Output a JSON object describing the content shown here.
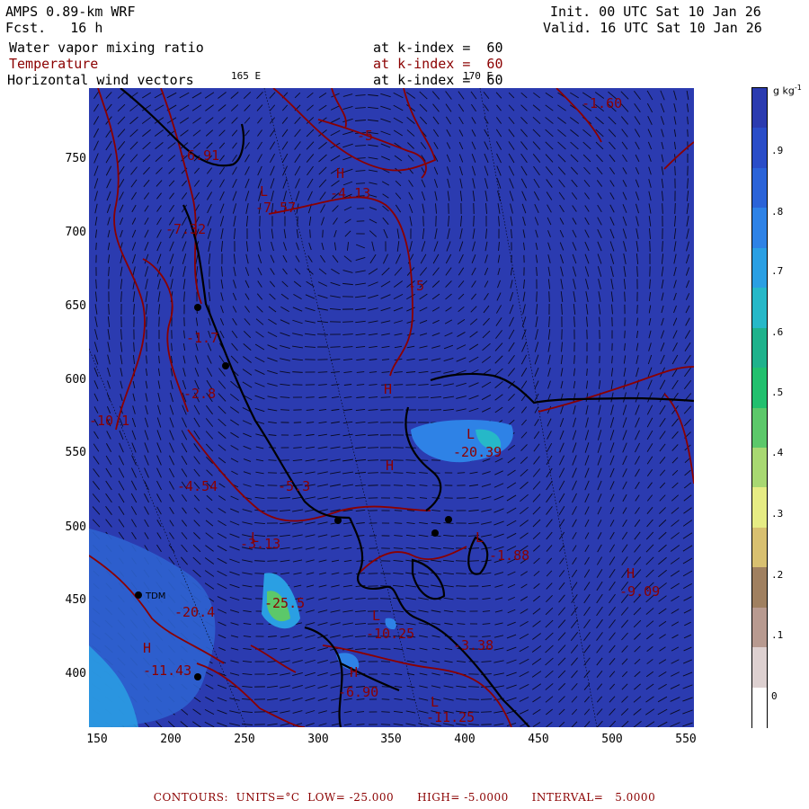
{
  "header": {
    "model": "AMPS 0.89-km WRF",
    "forecast": "Fcst.   16 h",
    "init": "Init. 00 UTC Sat 10 Jan 26",
    "valid": "Valid. 16 UTC Sat 10 Jan 26",
    "fields": [
      {
        "name": "Water vapor mixing ratio",
        "level": "at k-index =  60",
        "color": "#000000"
      },
      {
        "name": "Temperature",
        "level": "at k-index =  60",
        "color": "#8b0000"
      },
      {
        "name": "Horizontal wind vectors",
        "level": "at k-index =  60",
        "color": "#000000"
      }
    ]
  },
  "map": {
    "longitude_labels": [
      "165 E",
      "170 E"
    ],
    "x_ticks": [
      "150",
      "200",
      "250",
      "300",
      "350",
      "400",
      "450",
      "500",
      "550"
    ],
    "y_ticks": [
      "750",
      "700",
      "650",
      "600",
      "550",
      "500",
      "450",
      "400"
    ],
    "background_color": "#2b3bb0",
    "station_label": "TDM",
    "contour_labels": [
      {
        "text": "-1.60"
      },
      {
        "text": "-6.91"
      },
      {
        "text": "-7.57"
      },
      {
        "text": "-4.13"
      },
      {
        "text": "-5"
      },
      {
        "text": "-5"
      },
      {
        "text": "-7.32"
      },
      {
        "text": "-1.7"
      },
      {
        "text": "-2.8"
      },
      {
        "text": "-10.1"
      },
      {
        "text": "-4.54"
      },
      {
        "text": "-3.13"
      },
      {
        "text": "-20.39"
      },
      {
        "text": "-1.88"
      },
      {
        "text": "-9.09"
      },
      {
        "text": "-25.5"
      },
      {
        "text": "-20.4"
      },
      {
        "text": "-10.25"
      },
      {
        "text": "-11.43"
      },
      {
        "text": "-6.90"
      },
      {
        "text": "-11.25"
      },
      {
        "text": "-3.38"
      },
      {
        "text": "-5.3"
      }
    ],
    "extrema_markers": [
      {
        "text": "H"
      },
      {
        "text": "L"
      },
      {
        "text": "H"
      },
      {
        "text": "L"
      },
      {
        "text": "H"
      },
      {
        "text": "L"
      },
      {
        "text": "H"
      },
      {
        "text": "L"
      },
      {
        "text": "H"
      },
      {
        "text": "L"
      },
      {
        "text": "H"
      },
      {
        "text": "L"
      }
    ]
  },
  "colorbar": {
    "unit": "g kg",
    "unit_superscript": "-1",
    "ticks": [
      ".9",
      ".8",
      ".7",
      ".6",
      ".5",
      ".4",
      ".3",
      ".2",
      ".1",
      "0"
    ],
    "colors": [
      "#2b3bb0",
      "#2a4dc8",
      "#2b63d8",
      "#2e82e6",
      "#2a9fe3",
      "#26b8c8",
      "#1fb28c",
      "#22c06e",
      "#5cc86a",
      "#a8d872",
      "#e6ec84",
      "#d8c070",
      "#a08060",
      "#b89a90",
      "#ddd0d0",
      "#ffffff"
    ]
  },
  "footer": {
    "text": "CONTOURS:  UNITS=°C  LOW= -25.000      HIGH= -5.0000      INTERVAL=   5.0000"
  }
}
